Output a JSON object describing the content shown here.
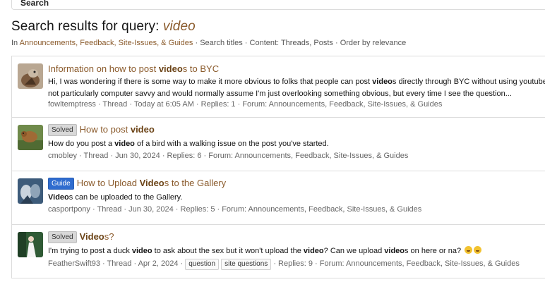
{
  "header": {
    "search_button_label": "Search"
  },
  "title": {
    "prefix": "Search results for query: ",
    "query": "video"
  },
  "filters": {
    "in_label": "In ",
    "forum": "Announcements, Feedback, Site-Issues, & Guides",
    "rest": " · Search titles · Content: Threads, Posts · Order by relevance"
  },
  "results": [
    {
      "title_pre": "Information on how to post ",
      "title_bold": "video",
      "title_post": "s to BYC",
      "snippet_1_pre": "Hi, I was wondering if there is some way to make it more obvious to folks that people can post ",
      "snippet_1_bold": "video",
      "snippet_1_post": "s directly through BYC without using youtube or s",
      "snippet_2": "not particularly computer savvy and would normally assume I'm just overlooking something obvious, but every time I see the question...",
      "meta": "fowltemptress · Thread · Today at 6:05 AM · Replies: 1 · Forum: Announcements, Feedback, Site-Issues, & Guides"
    },
    {
      "label": "Solved",
      "title_pre": "How to post ",
      "title_bold": "video",
      "title_post": "",
      "snippet_pre": "How do you post a ",
      "snippet_bold": "video",
      "snippet_post": " of a bird with a walking issue on the post you've started.",
      "meta": "cmobley · Thread · Jun 30, 2024 · Replies: 6 · Forum: Announcements, Feedback, Site-Issues, & Guides"
    },
    {
      "label": "Guide",
      "title_pre": "How to Upload ",
      "title_bold": "Video",
      "title_post": "s to the Gallery",
      "snippet_bold": "Video",
      "snippet_post": "s can be uploaded to the Gallery.",
      "meta": "casportpony · Thread · Jun 30, 2024 · Replies: 5 · Forum: Announcements, Feedback, Site-Issues, & Guides"
    },
    {
      "label": "Solved",
      "title_bold": "Video",
      "title_post": "s?",
      "snippet_a": "I'm trying to post a duck ",
      "snippet_b": "video",
      "snippet_c": " to ask about the sex but it won't upload the ",
      "snippet_d": "video",
      "snippet_e": "? Can we upload ",
      "snippet_f": "video",
      "snippet_g": "s on here or na?",
      "meta_pre": "FeatherSwift93 · Thread · Apr 2, 2024 · ",
      "tags": [
        "question",
        "site questions"
      ],
      "meta_post": " · Replies: 9 · Forum: Announcements, Feedback, Site-Issues, & Guides"
    }
  ],
  "colors": {
    "link": "#8a5a2b",
    "guide_label": "#2f6ccf",
    "solved_label": "#d8d8d8"
  }
}
